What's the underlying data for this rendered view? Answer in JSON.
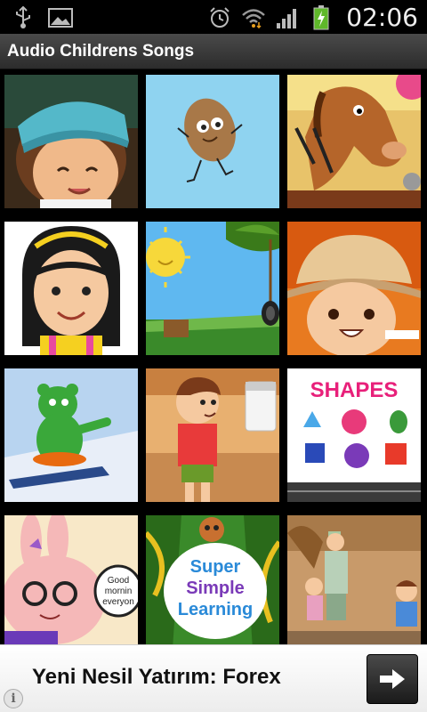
{
  "status_bar": {
    "time": "02:06",
    "icons_left": [
      "usb-icon",
      "gallery-icon"
    ],
    "icons_right": [
      "alarm-icon",
      "wifi-icon",
      "signal-icon",
      "battery-charging-icon"
    ]
  },
  "app": {
    "title": "Audio Childrens Songs"
  },
  "tiles": [
    {
      "label": "",
      "art": "kid-cap"
    },
    {
      "label": "",
      "art": "potato"
    },
    {
      "label": "",
      "art": "horse"
    },
    {
      "label": "",
      "art": "girl"
    },
    {
      "label": "",
      "art": "sun-swing"
    },
    {
      "label": "",
      "art": "kid-hat"
    },
    {
      "label": "",
      "art": "gummy-bear"
    },
    {
      "label": "",
      "art": "boy-sugar"
    },
    {
      "label": "SHAPES",
      "art": "shapes"
    },
    {
      "label": "Good morning everyone",
      "art": "bunny"
    },
    {
      "label": "Super Simple Learning",
      "art": "super-simple"
    },
    {
      "label": "",
      "art": "family-walk"
    }
  ],
  "ad": {
    "text": "Yeni Nesil Yatırım: Forex",
    "info_glyph": "i"
  },
  "colors": {
    "titlebar": "#3a3a3a",
    "background": "#000000",
    "ad_background": "#ffffff"
  }
}
